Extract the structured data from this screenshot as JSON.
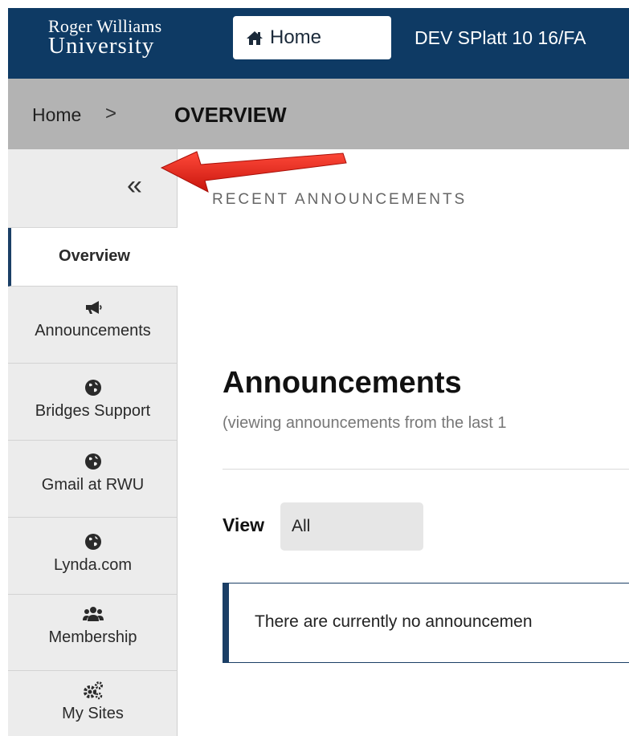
{
  "header": {
    "logo_line1": "Roger Williams",
    "logo_line2": "University",
    "home_label": "Home",
    "site_title": "DEV SPlatt 10 16/FA"
  },
  "breadcrumb": {
    "home": "Home",
    "separator": ">",
    "current": "OVERVIEW"
  },
  "sidebar": {
    "collapse_glyph": "«",
    "items": [
      {
        "label": "Overview",
        "icon": "none",
        "active": true
      },
      {
        "label": "Announcements",
        "icon": "megaphone-icon"
      },
      {
        "label": "Bridges Support",
        "icon": "globe-icon"
      },
      {
        "label": "Gmail at RWU",
        "icon": "globe-icon"
      },
      {
        "label": "Lynda.com",
        "icon": "globe-icon"
      },
      {
        "label": "Membership",
        "icon": "users-icon"
      },
      {
        "label": "My Sites",
        "icon": "gears-icon"
      }
    ]
  },
  "main": {
    "recent_heading": "RECENT ANNOUNCEMENTS",
    "announcements_title": "Announcements",
    "announcements_subtitle": "(viewing announcements from the last 1",
    "view_label": "View",
    "view_value": "All",
    "empty_message": "There are currently no announcemen"
  },
  "colors": {
    "header_bg": "#0e3a64",
    "breadcrumb_bg": "#b3b3b3",
    "sidebar_bg": "#ececec",
    "accent": "#1b3f66",
    "arrow": "#e02020"
  }
}
